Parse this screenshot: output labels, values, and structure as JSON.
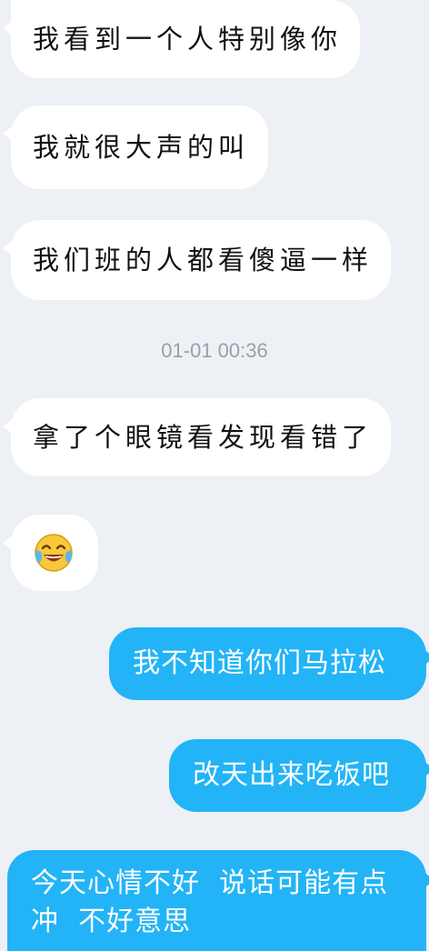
{
  "messages": [
    {
      "side": "in",
      "text": "我看到一个人特别像你"
    },
    {
      "side": "in",
      "text": "我就很大声的叫"
    },
    {
      "side": "in",
      "text": "我们班的人都看傻逼一样"
    },
    {
      "side": "in",
      "text": "拿了个眼镜看发现看错了"
    },
    {
      "side": "in",
      "emoji": "face-with-tears-of-joy"
    },
    {
      "side": "out",
      "text": "我不知道你们马拉松"
    },
    {
      "side": "out",
      "text": "改天出来吃饭吧"
    },
    {
      "side": "out",
      "text": "今天心情不好  说话可能有点冲  不好意思"
    }
  ],
  "timestamp": "01-01 00:36",
  "colors": {
    "background": "#edf0f5",
    "incoming_bubble": "#ffffff",
    "outgoing_bubble": "#22b4f6",
    "timestamp_text": "#9aa0a8"
  }
}
